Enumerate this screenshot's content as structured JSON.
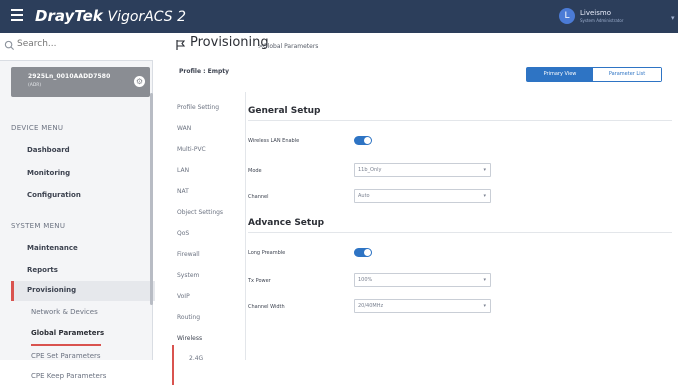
{
  "app": {
    "brand_main": "DrayTek",
    "brand_sub": "VigorACS 2"
  },
  "user": {
    "avatar_letter": "L",
    "name": "Liveismo",
    "subtitle": "System Administrator"
  },
  "sidebar": {
    "search_placeholder": "Search...",
    "device": {
      "name": "2925Ln_0010AADD7580",
      "sub": "(ADR)"
    },
    "device_menu_title": "DEVICE MENU",
    "device_menu": [
      "Dashboard",
      "Monitoring",
      "Configuration"
    ],
    "system_menu_title": "SYSTEM MENU",
    "system_menu": [
      "Maintenance",
      "Reports",
      "Provisioning"
    ],
    "provisioning_children": [
      "Network & Devices",
      "Global Parameters",
      "CPE Set Parameters",
      "CPE Keep Parameters"
    ]
  },
  "page": {
    "title": "Provisioning",
    "breadcrumb": ">Global Parameters",
    "profile_label": "Profile : Empty",
    "views": {
      "primary": "Primary View",
      "parameter": "Parameter List"
    }
  },
  "subnav": {
    "items": [
      "Profile Setting",
      "WAN",
      "Multi-PVC",
      "LAN",
      "NAT",
      "Object Settings",
      "QoS",
      "Firewall",
      "System",
      "VoIP",
      "Routing",
      "Wireless"
    ],
    "child": "2.4G"
  },
  "form": {
    "general_title": "General Setup",
    "advance_title": "Advance Setup",
    "fields": {
      "wireless_lan_enable": "Wireless LAN Enable",
      "mode": "Mode",
      "mode_value": "11b_Only",
      "channel": "Channel",
      "channel_value": "Auto",
      "long_preamble": "Long Preamble",
      "tx_power": "Tx Power",
      "tx_power_value": "100%",
      "channel_width": "Channel Width",
      "channel_width_value": "20/40MHz"
    }
  }
}
